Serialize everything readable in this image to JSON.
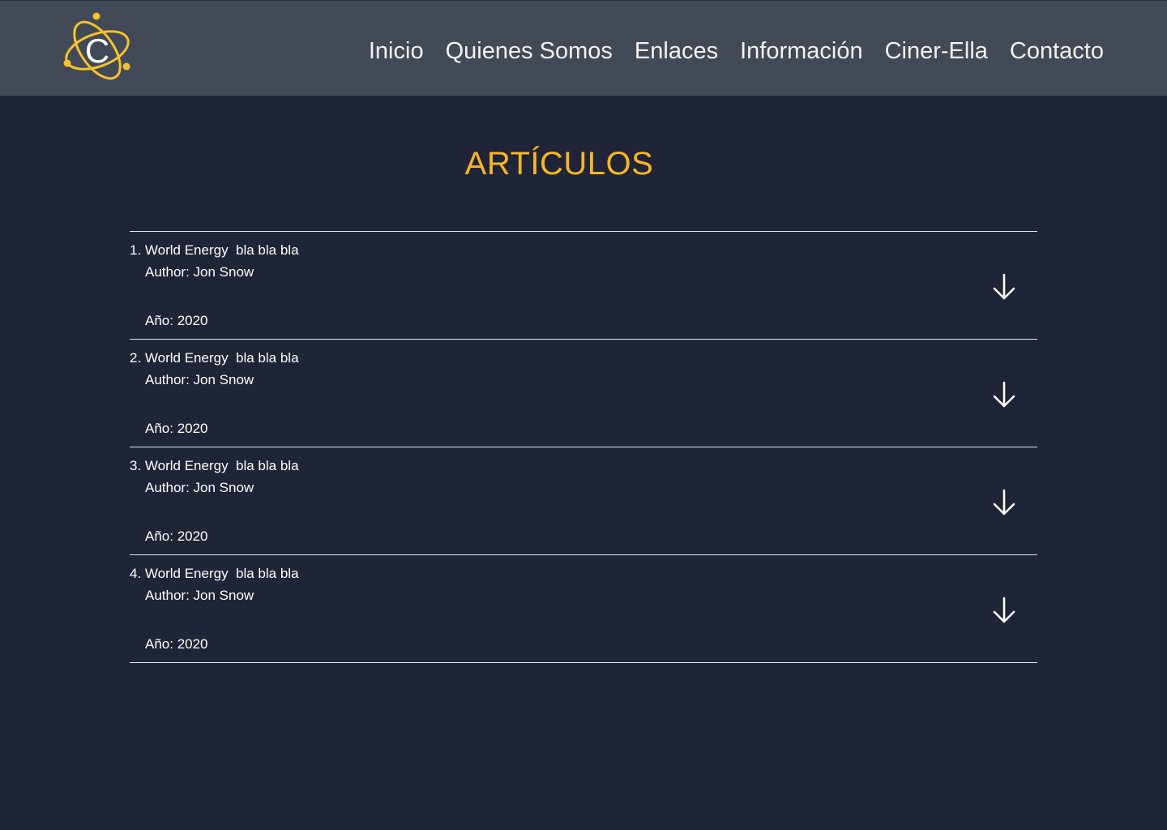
{
  "header": {
    "logo_letter": "C",
    "nav": [
      "Inicio",
      "Quienes Somos",
      "Enlaces",
      "Información",
      "Ciner-Ella",
      "Contacto"
    ]
  },
  "page_title": "ARTÍCULOS",
  "articles": [
    {
      "title": "1. World Energy  bla bla bla",
      "author": "Author: Jon Snow",
      "year": "Año: 2020",
      "icon": "arrow-down-icon"
    },
    {
      "title": "2. World Energy  bla bla bla",
      "author": "Author: Jon Snow",
      "year": "Año: 2020",
      "icon": "arrow-down-icon"
    },
    {
      "title": "3. World Energy  bla bla bla",
      "author": "Author: Jon Snow",
      "year": "Año: 2020",
      "icon": "arrow-down-icon"
    },
    {
      "title": "4. World Energy  bla bla bla",
      "author": "Author: Jon Snow",
      "year": "Año: 2020",
      "icon": "arrow-down-icon"
    }
  ],
  "colors": {
    "background": "#1f2536",
    "header": "#424957",
    "accent": "#f9b526"
  }
}
